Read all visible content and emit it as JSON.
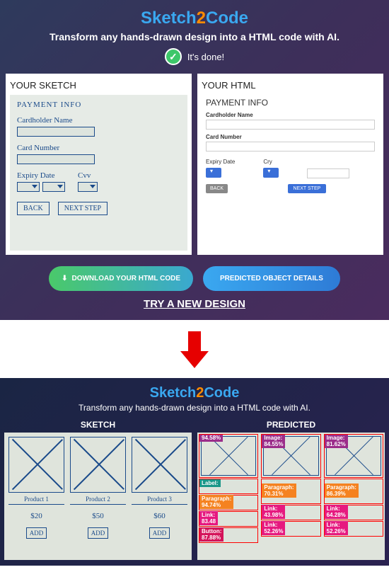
{
  "top": {
    "logo": {
      "s1": "Sketch",
      "two": "2",
      "s2": "Code"
    },
    "tagline": "Transform any hands-drawn design into a HTML code with AI.",
    "status": "It's done!",
    "panel1_title": "YOUR SKETCH",
    "panel2_title": "YOUR HTML",
    "sketch": {
      "title": "PAYMENT  INFO",
      "label1": "Cardholder Name",
      "label2": "Card Number",
      "label3": "Expiry Date",
      "label4": "Cvv",
      "back": "BACK",
      "next": "NEXT STEP"
    },
    "html": {
      "title": "PAYMENT INFO",
      "label1": "Cardholder Name",
      "label2": "Card Number",
      "label3": "Expiry Date",
      "label4": "Cry",
      "back": "BACK",
      "next": "NEXT STEP"
    },
    "btn_download": "DOWNLOAD YOUR HTML CODE",
    "btn_predicted": "PREDICTED OBJECT DETAILS",
    "try_link": "TRY A NEW DESIGN"
  },
  "bottom": {
    "logo": {
      "s1": "Sketch",
      "two": "2",
      "s2": "Code"
    },
    "tagline": "Transform any hands-drawn design into a HTML code with AI.",
    "col1": "SKETCH",
    "col2": "PREDICTED",
    "products": [
      {
        "name": "Product 1",
        "price": "$20",
        "btn": "ADD"
      },
      {
        "name": "Product 2",
        "price": "$50",
        "btn": "ADD"
      },
      {
        "name": "Product 3",
        "price": "$60",
        "btn": "ADD"
      }
    ],
    "predicted": {
      "img_conf": [
        "94.58%",
        "84.55%",
        "81.62%"
      ],
      "img_label": "Image:",
      "label_tag": "Label:",
      "para_tag": "Paragraph:",
      "para_conf": [
        "94.74%",
        "70.31%",
        "86.39%"
      ],
      "link_tag": "Link:",
      "link_conf": [
        "83.48",
        "43.98%",
        "64.28%"
      ],
      "link2_conf": "52.26%",
      "button_tag": "Button:",
      "button_conf": "87.88%"
    }
  }
}
